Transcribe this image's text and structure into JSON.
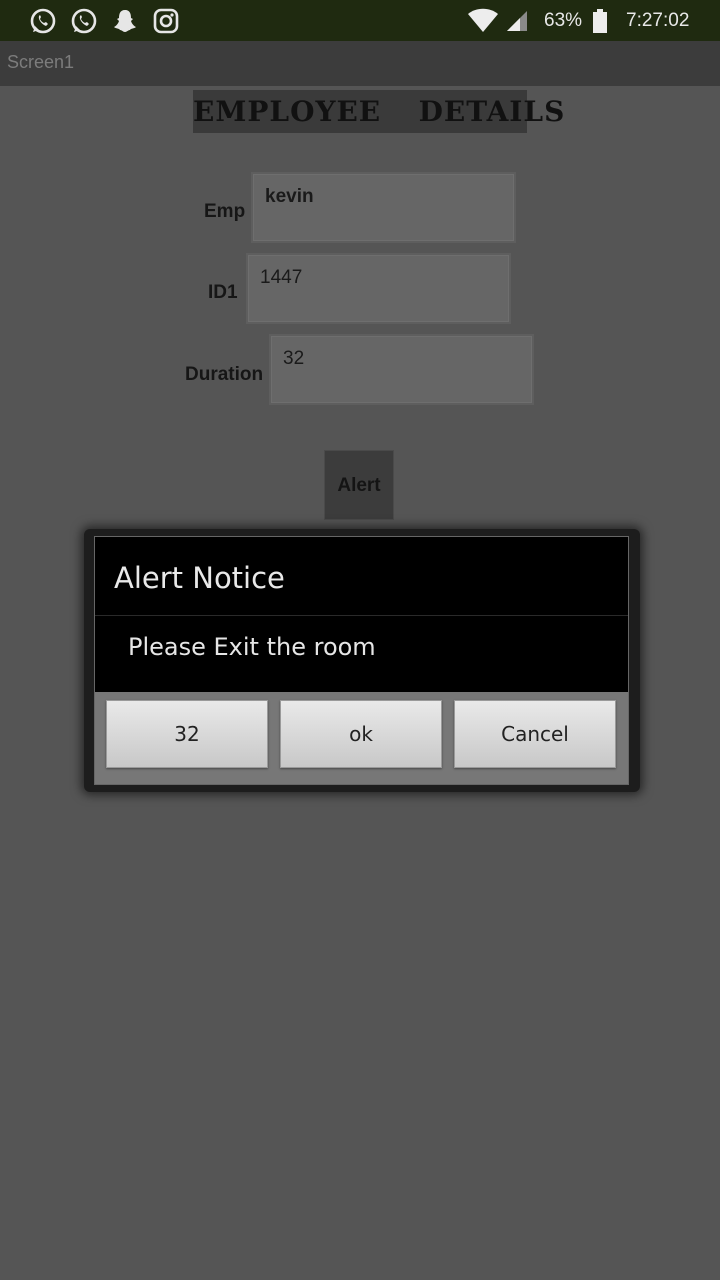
{
  "status_bar": {
    "notification_icons": [
      "whatsapp-icon",
      "whatsapp-icon",
      "snapchat-icon",
      "instagram-icon"
    ],
    "battery_percent": "63%",
    "time": "7:27:02"
  },
  "app": {
    "screen_title": "Screen1",
    "heading": "EMPLOYEE  DETAILS"
  },
  "form": {
    "emp": {
      "label": "Emp",
      "value": "kevin"
    },
    "id": {
      "label": "ID1",
      "value": "1447"
    },
    "duration": {
      "label": "Duration",
      "value": "32"
    },
    "alert_button": "Alert"
  },
  "dialog": {
    "title": "Alert Notice",
    "message": "Please Exit the room",
    "buttons": [
      "32",
      "ok",
      "Cancel"
    ]
  },
  "colors": {
    "status_bar_bg": "#1f2a10",
    "app_bg": "#555555",
    "dialog_bg": "#000000"
  }
}
